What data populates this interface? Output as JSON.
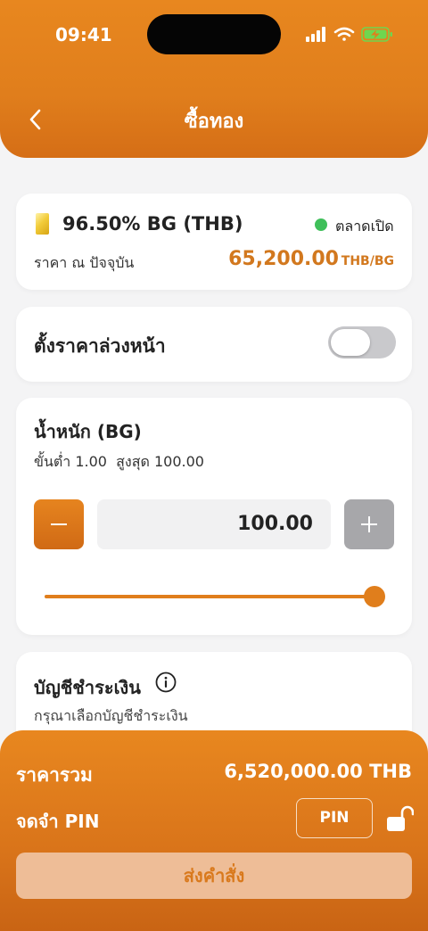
{
  "status_bar": {
    "time": "09:41"
  },
  "header": {
    "title": "ซื้อทอง"
  },
  "product": {
    "name": "96.50% BG (THB)",
    "market_status": "ตลาดเปิด",
    "price_label": "ราคา ณ ปัจจุบัน",
    "price_value": "65,200.00",
    "price_unit": "THB/BG"
  },
  "advance_price": {
    "label": "ตั้งราคาล่วงหน้า",
    "enabled": false
  },
  "weight": {
    "title": "น้ำหนัก (BG)",
    "range_text": "ขั้นต่ำ 1.00  สูงสุด 100.00",
    "value": "100.00",
    "slider_fraction": 1.0
  },
  "payment_account": {
    "title": "บัญชีชำระเงิน",
    "hint": "กรุณาเลือกบัญชีชำระเงิน"
  },
  "footer": {
    "total_label": "ราคารวม",
    "total_value": "6,520,000.00 THB",
    "pin_label": "จดจำ PIN",
    "pin_button": "PIN",
    "submit_label": "ส่งคำสั่ง"
  },
  "colors": {
    "accent": "#e07e1c",
    "price_text": "#d2781e",
    "market_open": "#3fbf5a"
  }
}
